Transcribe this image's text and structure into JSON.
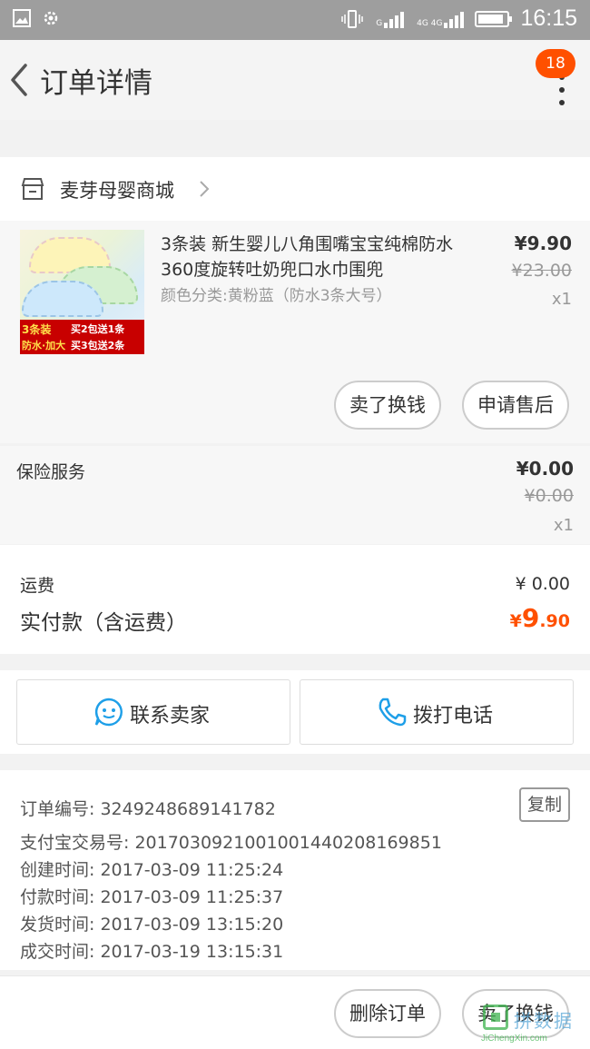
{
  "status_bar": {
    "time": "16:15",
    "sim1_label": "G",
    "sim2_label": "4G 4G",
    "battery_level": 0.9
  },
  "nav": {
    "title": "订单详情",
    "badge_count": "18"
  },
  "shop": {
    "name": "麦芽母婴商城"
  },
  "item": {
    "title": "3条装 新生婴儿八角围嘴宝宝纯棉防水360度旋转吐奶兜口水巾围兜",
    "sku": "颜色分类:黄粉蓝（防水3条大号）",
    "price": "¥9.90",
    "original_price": "¥23.00",
    "quantity": "x1",
    "thumb_promo": [
      "3条装",
      "买2包送1条",
      "防水·加大",
      "买3包送2条"
    ],
    "actions": [
      "卖了换钱",
      "申请售后"
    ]
  },
  "insurance": {
    "label": "保险服务",
    "price": "¥0.00",
    "original_price": "¥0.00",
    "quantity": "x1"
  },
  "payment": {
    "shipping_label": "运费",
    "shipping_value": "¥ 0.00",
    "total_label": "实付款（含运费）",
    "total_currency": "¥",
    "total_int": "9",
    "total_dec": ".90"
  },
  "contact": {
    "seller_label": "联系卖家",
    "call_label": "拨打电话"
  },
  "order_info": {
    "order_no": "订单编号: 3249248689141782",
    "copy_label": "复制",
    "alipay_no": "支付宝交易号: 2017030921001001440208169851",
    "created": "创建时间: 2017-03-09 11:25:24",
    "paid": "付款时间: 2017-03-09 11:25:37",
    "shipped": "发货时间: 2017-03-09 13:15:20",
    "completed": "成交时间: 2017-03-19 13:15:31"
  },
  "bottom": {
    "delete_label": "删除订单",
    "resell_label": "卖了换钱"
  },
  "watermark": {
    "text": "JiChengXin.com",
    "cn": "拼数据"
  },
  "colors": {
    "accent": "#ff5000",
    "status_bar": "#9e9e9e",
    "contact_icon": "#1e9fe8"
  }
}
